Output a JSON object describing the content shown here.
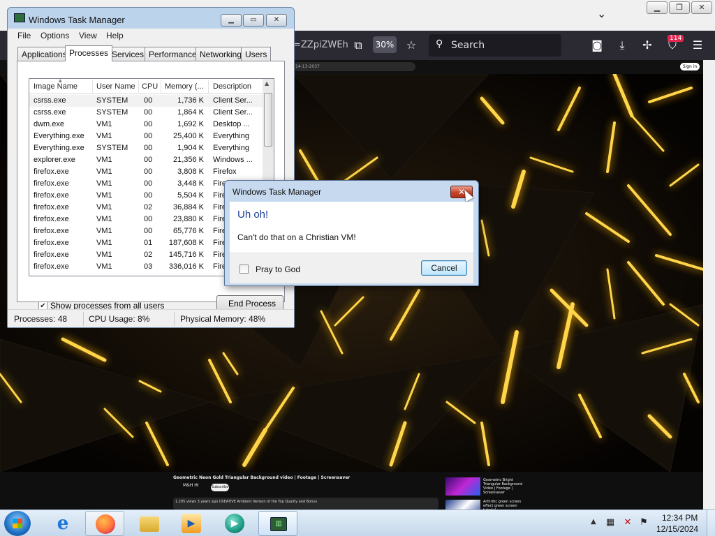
{
  "firefox": {
    "url_fragment": "=ZZpiZWEh",
    "zoom": "30%",
    "search_placeholder": "Search",
    "extension_badge": "114"
  },
  "youtube": {
    "mini_url": "14-13-2037",
    "sign_in": "Sign in",
    "title": "Geometric Neon Gold Triangular Background video | Footage | Screensaver",
    "channel": "M&H HI",
    "subscribe": "Subscribe",
    "meta": "1,205 views  3 years ago  CREATIVE Ambient Version of the Top Quality and Bonus",
    "side_1": "Geometric Bright Triangular Background Video | Footage | Screensaver",
    "side_2": "Arthritic green screen effect green screen tutorial"
  },
  "taskmanager": {
    "title": "Windows Task Manager",
    "menu": [
      "File",
      "Options",
      "View",
      "Help"
    ],
    "tabs": [
      "Applications",
      "Processes",
      "Services",
      "Performance",
      "Networking",
      "Users"
    ],
    "active_tab": "Processes",
    "columns": [
      "Image Name",
      "User Name",
      "CPU",
      "Memory (...",
      "Description"
    ],
    "rows": [
      {
        "name": "csrss.exe",
        "user": "SYSTEM",
        "cpu": "00",
        "mem": "1,736 K",
        "desc": "Client Ser..."
      },
      {
        "name": "csrss.exe",
        "user": "SYSTEM",
        "cpu": "00",
        "mem": "1,864 K",
        "desc": "Client Ser..."
      },
      {
        "name": "dwm.exe",
        "user": "VM1",
        "cpu": "00",
        "mem": "1,692 K",
        "desc": "Desktop ..."
      },
      {
        "name": "Everything.exe",
        "user": "VM1",
        "cpu": "00",
        "mem": "25,400 K",
        "desc": "Everything"
      },
      {
        "name": "Everything.exe",
        "user": "SYSTEM",
        "cpu": "00",
        "mem": "1,904 K",
        "desc": "Everything"
      },
      {
        "name": "explorer.exe",
        "user": "VM1",
        "cpu": "00",
        "mem": "21,356 K",
        "desc": "Windows ..."
      },
      {
        "name": "firefox.exe",
        "user": "VM1",
        "cpu": "00",
        "mem": "3,808 K",
        "desc": "Firefox"
      },
      {
        "name": "firefox.exe",
        "user": "VM1",
        "cpu": "00",
        "mem": "3,448 K",
        "desc": "Firefox"
      },
      {
        "name": "firefox.exe",
        "user": "VM1",
        "cpu": "00",
        "mem": "5,504 K",
        "desc": "Fire"
      },
      {
        "name": "firefox.exe",
        "user": "VM1",
        "cpu": "02",
        "mem": "36,884 K",
        "desc": "Fire"
      },
      {
        "name": "firefox.exe",
        "user": "VM1",
        "cpu": "00",
        "mem": "23,880 K",
        "desc": "Fire"
      },
      {
        "name": "firefox.exe",
        "user": "VM1",
        "cpu": "00",
        "mem": "65,776 K",
        "desc": "Fire"
      },
      {
        "name": "firefox.exe",
        "user": "VM1",
        "cpu": "01",
        "mem": "187,608 K",
        "desc": "Fire"
      },
      {
        "name": "firefox.exe",
        "user": "VM1",
        "cpu": "02",
        "mem": "145,716 K",
        "desc": "Fire"
      },
      {
        "name": "firefox.exe",
        "user": "VM1",
        "cpu": "03",
        "mem": "336,016 K",
        "desc": "Fire"
      }
    ],
    "show_all_label": "Show processes from all users",
    "show_all_checked": true,
    "end_process_label": "End Process",
    "status": {
      "processes": "Processes: 48",
      "cpu": "CPU Usage: 8%",
      "memory": "Physical Memory: 48%"
    }
  },
  "dialog": {
    "title": "Windows Task Manager",
    "heading": "Uh oh!",
    "message": "Can't do that on a Christian VM!",
    "checkbox_label": "Pray to God",
    "checkbox_checked": false,
    "cancel_label": "Cancel"
  },
  "taskbar": {
    "items": [
      "start-button",
      "internet-explorer",
      "firefox",
      "file-explorer",
      "media-player",
      "app-circle",
      "task-manager"
    ],
    "active_item": "task-manager",
    "time": "12:34 PM",
    "date": "12/15/2024"
  },
  "colors": {
    "firefox_toolbar": "#2b2a33",
    "dialog_heading": "#1d3f93",
    "close_button": "#c7442a",
    "neon_gold": "#ffd54a"
  }
}
